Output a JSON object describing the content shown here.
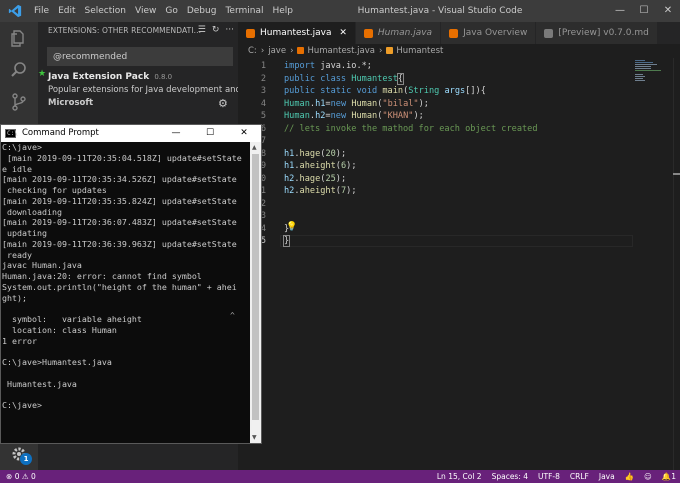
{
  "window": {
    "title": "Humantest.java - Visual Studio Code",
    "controls": [
      "—",
      "☐",
      "✕"
    ]
  },
  "menu": [
    "File",
    "Edit",
    "Selection",
    "View",
    "Go",
    "Debug",
    "Terminal",
    "Help"
  ],
  "sidebar": {
    "header": "EXTENSIONS: OTHER RECOMMENDATI...",
    "search_value": "@recommended",
    "extension": {
      "name": "Java Extension Pack",
      "version": "0.8.0",
      "description": "Popular extensions for Java development and ...",
      "publisher": "Microsoft"
    }
  },
  "tabs": [
    {
      "label": "Humantest.java",
      "active": true,
      "italic": false,
      "icon": "java"
    },
    {
      "label": "Human.java",
      "active": false,
      "italic": true,
      "icon": "java"
    },
    {
      "label": "Java Overview",
      "active": false,
      "italic": false,
      "icon": "java"
    },
    {
      "label": "[Preview] v0.7.0.md",
      "active": false,
      "italic": false,
      "icon": "preview"
    }
  ],
  "breadcrumb": {
    "drive": "C:",
    "folder": "jave",
    "file": "Humantest.java",
    "symbol": "Humantest"
  },
  "code_lines": [
    {
      "n": "1",
      "html": "<span class=\"kw\">import</span> <span class=\"df\">java.io.*;</span>"
    },
    {
      "n": "2",
      "html": "<span class=\"kw\">public</span> <span class=\"kw\">class</span> <span class=\"ty\">Humantest</span><span class=\"br\">{</span>"
    },
    {
      "n": "3",
      "html": "<span class=\"kw\">public</span> <span class=\"kw\">static</span> <span class=\"kw\">void</span> <span class=\"fn\">main</span><span class=\"df\">(</span><span class=\"ty\">String</span> <span class=\"vr\">args</span><span class=\"df\">[]){</span>"
    },
    {
      "n": "4",
      "html": "<span class=\"ty\">Human</span><span class=\"df\">.</span><span class=\"vr\">h1</span><span class=\"df\">=</span><span class=\"kw\">new</span> <span class=\"fn\">Human</span><span class=\"df\">(</span><span class=\"st\">\"bilal\"</span><span class=\"df\">);</span>"
    },
    {
      "n": "5",
      "html": "<span class=\"ty\">Human</span><span class=\"df\">.</span><span class=\"vr\">h2</span><span class=\"df\">=</span><span class=\"kw\">new</span> <span class=\"fn\">Human</span><span class=\"df\">(</span><span class=\"st\">\"KHAN\"</span><span class=\"df\">);</span>"
    },
    {
      "n": "6",
      "html": "<span class=\"cm\">// lets invoke the mathod for each object created</span>"
    },
    {
      "n": "7",
      "html": ""
    },
    {
      "n": "8",
      "html": "<span class=\"vr\">h1</span><span class=\"df\">.</span><span class=\"fn\">hage</span><span class=\"df\">(</span><span class=\"nu\">20</span><span class=\"df\">);</span>"
    },
    {
      "n": "9",
      "html": "<span class=\"vr\">h1</span><span class=\"df\">.</span><span class=\"fn\">aheight</span><span class=\"df\">(</span><span class=\"nu\">6</span><span class=\"df\">);</span>"
    },
    {
      "n": "10",
      "html": "<span class=\"vr\">h2</span><span class=\"df\">.</span><span class=\"fn\">hage</span><span class=\"df\">(</span><span class=\"nu\">25</span><span class=\"df\">);</span>"
    },
    {
      "n": "11",
      "html": "<span class=\"vr\">h2</span><span class=\"df\">.</span><span class=\"fn\">aheight</span><span class=\"df\">(</span><span class=\"nu\">7</span><span class=\"df\">);</span>"
    },
    {
      "n": "12",
      "html": ""
    },
    {
      "n": "13",
      "html": ""
    },
    {
      "n": "14",
      "html": "<span class=\"df\">}</span>"
    },
    {
      "n": "15",
      "html": "<span class=\"br\">}</span>"
    }
  ],
  "statusbar": {
    "errors": "0",
    "warnings": "0",
    "position": "Ln 15, Col 2",
    "spaces": "Spaces: 4",
    "encoding": "UTF-8",
    "eol": "CRLF",
    "language": "Java",
    "notifications": "1"
  },
  "activity_badge": "1",
  "cmd": {
    "title": "Command Prompt",
    "lines": [
      "C:\\jave>",
      " [main 2019-09-11T20:35:04.518Z] update#setState",
      "e idle",
      "[main 2019-09-11T20:35:34.526Z] update#setState",
      " checking for updates",
      "[main 2019-09-11T20:35:35.824Z] update#setState",
      " downloading",
      "[main 2019-09-11T20:36:07.483Z] update#setState",
      " updating",
      "[main 2019-09-11T20:36:39.963Z] update#setState",
      " ready",
      "javac Human.java",
      "Human.java:20: error: cannot find symbol",
      "System.out.println(\"height of the human\" + ahei",
      "ght);",
      "",
      "  symbol:   variable aheight",
      "  location: class Human",
      "1 error",
      "",
      "C:\\jave>Humantest.java",
      "",
      " Humantest.java",
      "",
      "C:\\jave>"
    ],
    "caret": "^"
  }
}
